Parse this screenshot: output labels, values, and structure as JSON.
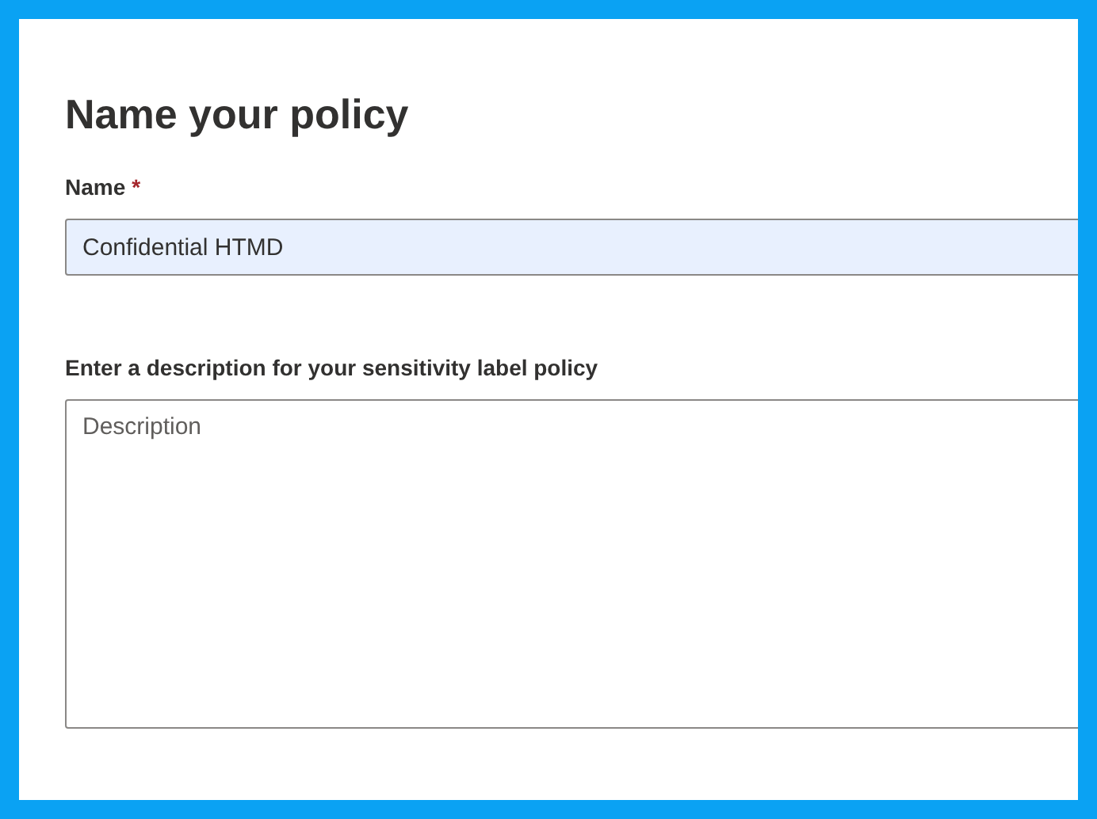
{
  "title": "Name your policy",
  "name_field": {
    "label": "Name",
    "required_mark": "*",
    "value": "Confidential HTMD"
  },
  "description_field": {
    "label": "Enter a description for your sensitivity label policy",
    "placeholder": "Description"
  }
}
